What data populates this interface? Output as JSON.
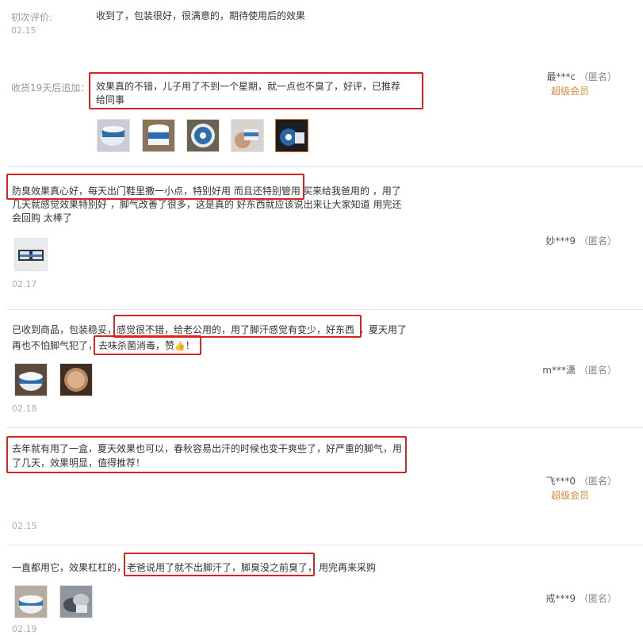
{
  "reviews": [
    {
      "initial_label": "初次评价:",
      "initial_text": "收到了，包装很好，很满意的，期待使用后的效果",
      "date": "02.15",
      "append_label": "收货19天后追加：",
      "append_line1": "效果真的不错，儿子用了不到一个星期，就一点也不臭了，好评，已推荐",
      "append_line2": "给同事",
      "user": "最***c",
      "anon": "（匿名）",
      "member": "超级会员",
      "thumb_icons": [
        "product-photo-icon",
        "product-photo-icon",
        "product-photo-icon",
        "product-photo-icon",
        "product-photo-icon"
      ]
    },
    {
      "line1a": "防臭效果真心好，每天出门鞋里撒一小点，特别好用 而且还特别管用",
      "line1b": "买来给我爸用的 ，用了",
      "line2": "几天就感觉效果特别好 ，脚气改善了很多，这是真的 好东西就应该说出来让大家知道 用完还",
      "line3": "会回购 太棒了",
      "date": "02.17",
      "user": "妙***9",
      "anon": "（匿名）"
    },
    {
      "line1a": "已收到商品，包装稳妥，",
      "line1b": "感觉很不错，给老公用的，用了脚汗感觉有变少，好东西",
      "line1c": "，夏天用了",
      "line2a": "再也不怕脚气犯了，",
      "line2b": "去味杀菌消毒，赞",
      "thumbs_up": "👍",
      "line2c": "！",
      "date": "02.18",
      "user": "m***潇",
      "anon": "（匿名）"
    },
    {
      "line1": "去年就有用了一盒，夏天效果也可以，春秋容易出汗的时候也变干爽些了，好严重的脚气，用",
      "line2": "了几天，效果明显，值得推荐！",
      "date": "02.15",
      "user": "飞***0",
      "anon": "（匿名）",
      "member": "超级会员"
    },
    {
      "line1a": "一直都用它，效果杠杠的，",
      "line1b": "老爸说用了就不出脚汗了，脚臭没之前臭了，",
      "line1c": "用完再来采购",
      "date": "02.19",
      "user": "戒***9",
      "anon": "（匿名）"
    }
  ],
  "colors": {
    "highlight_border": "#d9231d",
    "member": "#d48a3c",
    "label": "#999999",
    "text": "#333333"
  }
}
